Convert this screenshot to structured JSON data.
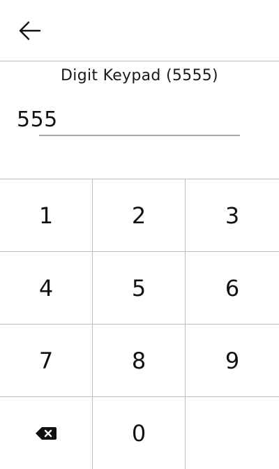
{
  "header": {
    "back_icon": "arrow-left-icon"
  },
  "title": "Digit Keypad (5555)",
  "entry": {
    "value": "555"
  },
  "keypad": {
    "keys": [
      "1",
      "2",
      "3",
      "4",
      "5",
      "6",
      "7",
      "8",
      "9"
    ],
    "backspace_icon": "backspace-icon",
    "zero": "0"
  },
  "colors": {
    "divider": "#bdbdbd",
    "underline": "#a8a8a8",
    "text": "#111111"
  }
}
